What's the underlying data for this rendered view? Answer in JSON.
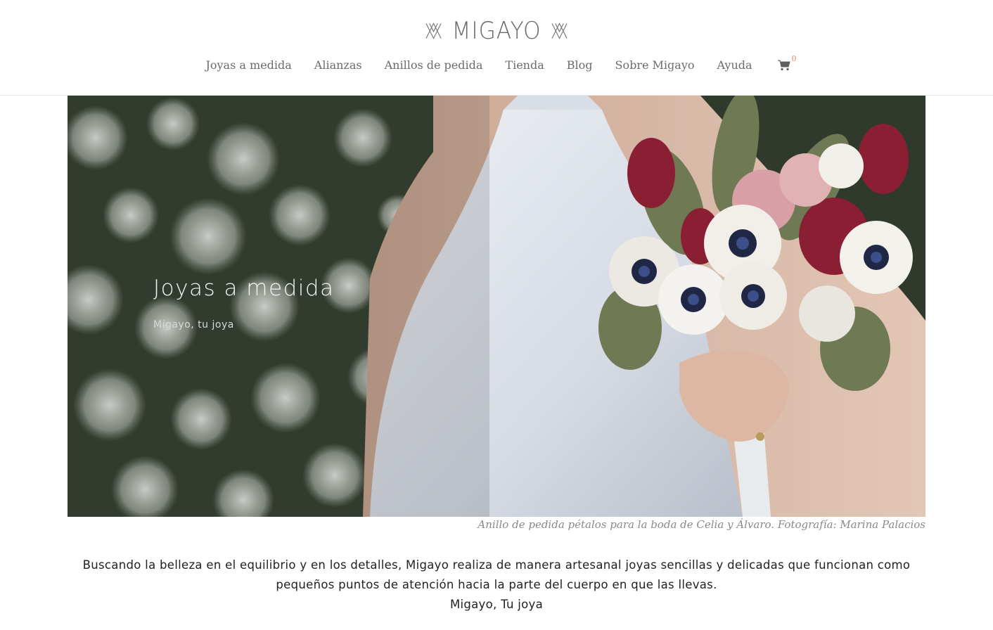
{
  "brand": {
    "logo_text": "MIGAYO"
  },
  "nav": {
    "items": [
      {
        "label": "Joyas a medida"
      },
      {
        "label": "Alianzas"
      },
      {
        "label": "Anillos de pedida"
      },
      {
        "label": "Tienda"
      },
      {
        "label": "Blog"
      },
      {
        "label": "Sobre Migayo"
      },
      {
        "label": "Ayuda"
      }
    ],
    "cart_count": "0",
    "cart_icon": "shopping-cart-icon"
  },
  "hero": {
    "title": "Joyas a medida",
    "subtitle": "Migayo, tu joya"
  },
  "caption": "Anillo de pedida pétalos para la boda de Celia y Álvaro. Fotografía: Marina Palacios",
  "intro": {
    "line1": "Buscando la belleza en el equilibrio y en los detalles, Migayo realiza de manera artesanal joyas sencillas y delicadas que funcionan como pequeños puntos de atención hacia la parte del cuerpo en que las llevas.",
    "line2": "Migayo, Tu joya"
  },
  "colors": {
    "accent": "#e08a5a",
    "nav_text": "#6b6b6b",
    "border": "#e6e6e6"
  }
}
